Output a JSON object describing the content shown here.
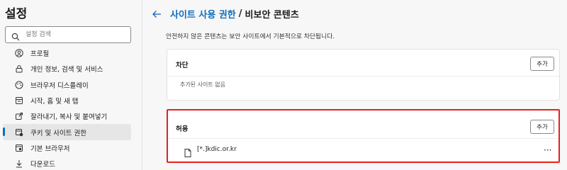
{
  "sidebar": {
    "title": "설정",
    "search_placeholder": "설정 검색",
    "items": [
      {
        "label": "프로필",
        "icon": "profile-icon"
      },
      {
        "label": "개인 정보, 검색 및 서비스",
        "icon": "lock-icon"
      },
      {
        "label": "브라우저 디스플레이",
        "icon": "display-icon"
      },
      {
        "label": "시작, 홈 및 새 탭",
        "icon": "tab-icon"
      },
      {
        "label": "잘라내기, 복사 및 붙여넣기",
        "icon": "share-icon"
      },
      {
        "label": "쿠키 및 사이트 권한",
        "icon": "cookie-icon",
        "active": true
      },
      {
        "label": "기본 브라우저",
        "icon": "browser-icon"
      },
      {
        "label": "다운로드",
        "icon": "download-icon"
      }
    ]
  },
  "header": {
    "breadcrumb_link": "사이트 사용 권한",
    "separator": "/",
    "current": "비보안 콘텐츠"
  },
  "description": "안전하지 않은 콘텐츠는 보안 사이트에서 기본적으로 차단됩니다.",
  "block_section": {
    "title": "차단",
    "add_label": "추가",
    "empty_text": "추가된 사이트 없음"
  },
  "allow_section": {
    "title": "허용",
    "add_label": "추가",
    "sites": [
      "[*.]kdic.or.kr"
    ]
  },
  "colors": {
    "accent": "#0f6cbd",
    "highlight_border": "#e2231a"
  }
}
